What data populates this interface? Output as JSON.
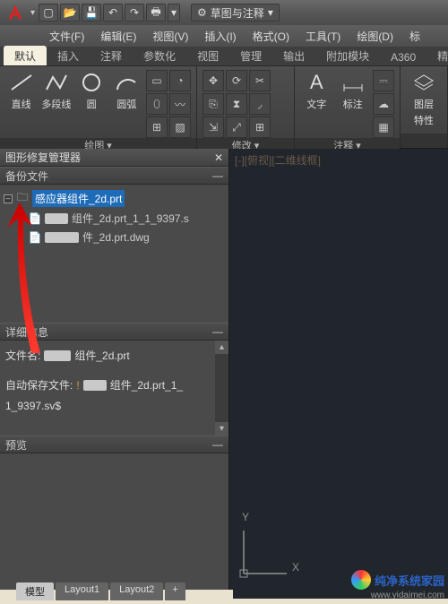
{
  "quickAccess": {
    "workspace_label": "草图与注释"
  },
  "menu": {
    "file": "文件(F)",
    "edit": "编辑(E)",
    "view": "视图(V)",
    "insert": "插入(I)",
    "format": "格式(O)",
    "tools": "工具(T)",
    "draw": "绘图(D)",
    "more": "标"
  },
  "ribbon": {
    "tabs": {
      "default": "默认",
      "insert": "插入",
      "annotate": "注释",
      "parametric": "参数化",
      "view": "视图",
      "manage": "管理",
      "output": "输出",
      "addins": "附加模块",
      "a360": "A360",
      "featured": "精选应用"
    },
    "group_draw": {
      "title": "绘图 ▾",
      "line": "直线",
      "polyline": "多段线",
      "circle": "圆",
      "arc": "圆弧"
    },
    "group_modify": {
      "title": "修改 ▾"
    },
    "group_annotate": {
      "title": "注释 ▾",
      "text": "文字",
      "dim": "标注"
    },
    "group_layers": {
      "label1": "图层",
      "label2": "特性"
    }
  },
  "panel": {
    "title": "图形修复管理器",
    "backup_section": "备份文件",
    "tree": {
      "root": "感应器组件_2d.prt",
      "child1_suffix": "组件_2d.prt_1_1_9397.s",
      "child2_suffix": "件_2d.prt.dwg"
    },
    "details_section": "详细信息",
    "details": {
      "filename_label": "文件名:",
      "filename_suffix": "组件_2d.prt",
      "autosave_label": "自动保存文件:",
      "autosave_mid": "组件_2d.prt_1_",
      "autosave_line2": "1_9397.sv$"
    },
    "preview_section": "预览"
  },
  "canvas": {
    "view_label": "[-][俯视][二维线框]"
  },
  "ucs": {
    "x": "X",
    "y": "Y"
  },
  "bottomTabs": {
    "model": "模型",
    "layout1": "Layout1",
    "layout2": "Layout2",
    "plus": "+"
  },
  "watermark": {
    "text": "纯净系统家园",
    "url": "www.yidaimei.com"
  },
  "collapse_glyph": "—",
  "expand_glyph": "+",
  "minus_glyph": "–",
  "dd_glyph": "▾",
  "up_glyph": "▴",
  "down_glyph": "▾"
}
